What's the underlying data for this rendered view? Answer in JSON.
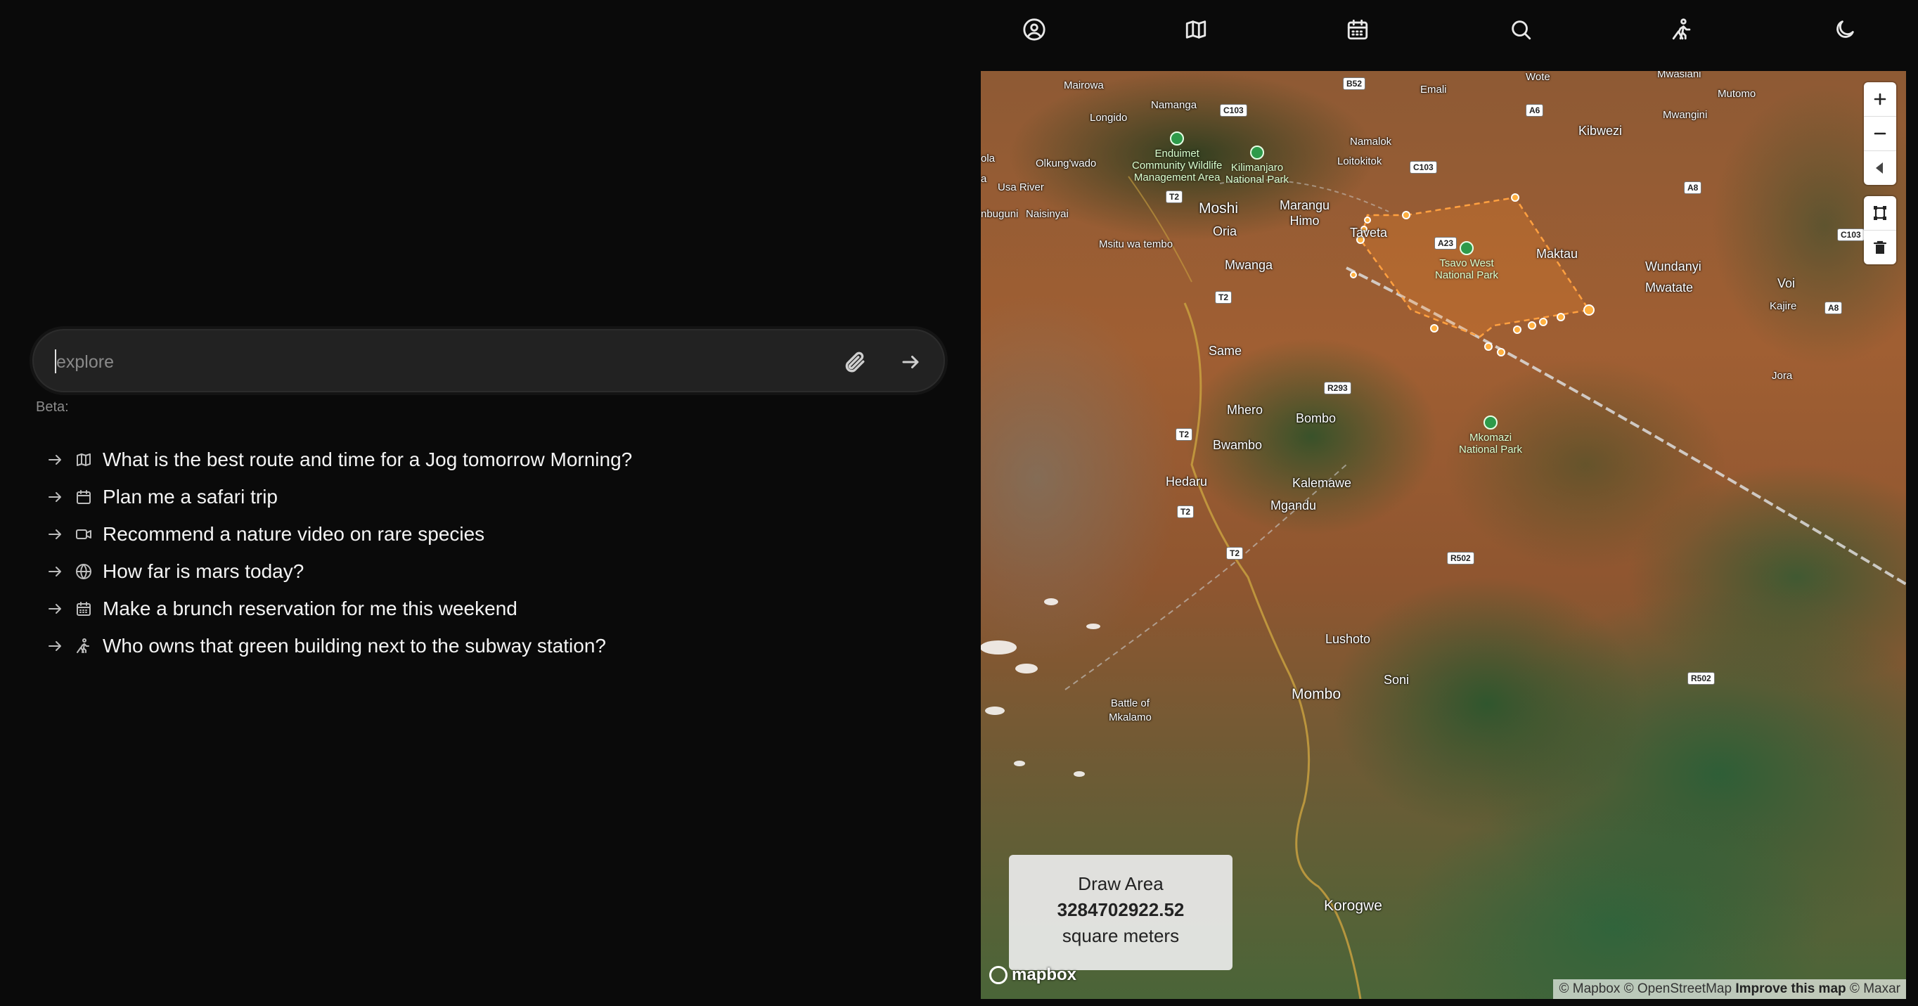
{
  "nav": {
    "icons": [
      "user-circle-icon",
      "map-icon",
      "calendar-icon",
      "search-icon",
      "hiker-icon",
      "moon-icon"
    ]
  },
  "chat": {
    "placeholder": "explore",
    "beta_label": "Beta:",
    "suggestions": [
      {
        "icon": "map-icon",
        "text": "What is the best route and time for a Jog tomorrow Morning?"
      },
      {
        "icon": "calendar-icon",
        "text": "Plan me a safari trip"
      },
      {
        "icon": "video-icon",
        "text": "Recommend a nature video on rare species"
      },
      {
        "icon": "globe-icon",
        "text": "How far is mars today?"
      },
      {
        "icon": "calendar-icon",
        "text": "Make a brunch reservation for me this weekend"
      },
      {
        "icon": "hiker-icon",
        "text": "Who owns that green building next to the subway station?"
      }
    ]
  },
  "map": {
    "places": {
      "mairowa": "Mairowa",
      "namanga": "Namanga",
      "longido": "Longido",
      "olkung_wado": "Olkung'wado",
      "usa_river": "Usa River",
      "ola": "ola",
      "a_label": "a",
      "nbuguni": "nbuguni",
      "naisinyai": "Naisinyai",
      "moshi": "Moshi",
      "oria": "Oria",
      "marangu_himo": "Marangu\nHimo",
      "taveta": "Taveta",
      "msitu": "Msitu wa tembo",
      "mwanga": "Mwanga",
      "same": "Same",
      "mhero": "Mhero",
      "bombo": "Bombo",
      "bwambo": "Bwambo",
      "hedaru": "Hedaru",
      "kalemawe": "Kalemawe",
      "mgandu": "Mgandu",
      "lushoto": "Lushoto",
      "soni": "Soni",
      "mombo": "Mombo",
      "battle": "Battle of\nMkalamo",
      "korogwe": "Korogwe",
      "namalok": "Namalok",
      "loitokitok": "Loitokitok",
      "kibwezi": "Kibwezi",
      "emali": "Emali",
      "maktau": "Maktau",
      "wundanyi": "Wundanyi",
      "mwatate": "Mwatate",
      "voi": "Voi",
      "kajire": "Kajire",
      "jora": "Jora",
      "mutomo": "Mutomo",
      "mwangini": "Mwangini",
      "wote": "Wote",
      "mwasiani": "Mwasiani"
    },
    "parks": {
      "enduimet": "Enduimet\nCommunity Wildlife\nManagement Area",
      "kilimanjaro": "Kilimanjaro\nNational Park",
      "tsavo": "Tsavo West\nNational Park",
      "mkomazi": "Mkomazi\nNational Park"
    },
    "roads": {
      "b52": "B52",
      "c103a": "C103",
      "a6": "A6",
      "c103b": "C103",
      "a8a": "A8",
      "t2a": "T2",
      "a23": "A23",
      "c103c": "C103",
      "t2b": "T2",
      "r293": "R293",
      "t2c": "T2",
      "t2d": "T2",
      "t2e": "T2",
      "a8b": "A8",
      "r502a": "R502",
      "r502b": "R502"
    },
    "draw_area": {
      "title": "Draw Area",
      "value": "3284702922.52",
      "unit": "square meters"
    },
    "logo": "mapbox",
    "attribution": {
      "a": "© Mapbox © OpenStreetMap ",
      "improve": "Improve this map",
      "b": " © Maxar"
    }
  }
}
